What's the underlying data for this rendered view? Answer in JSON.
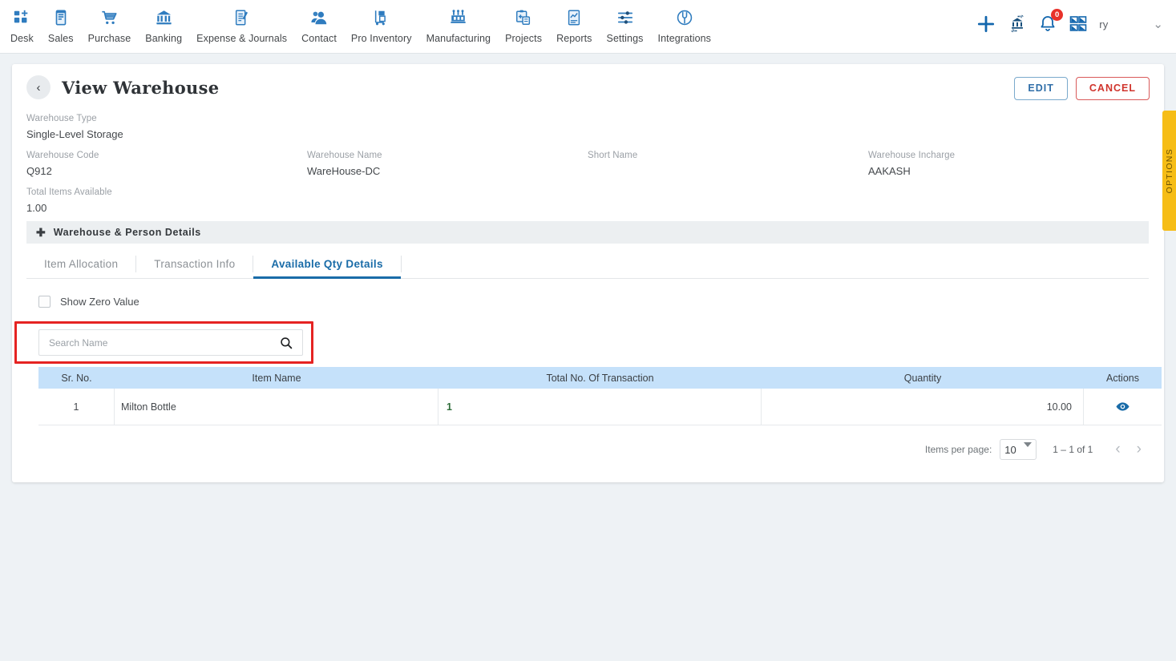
{
  "nav": {
    "items": [
      {
        "label": "Desk",
        "icon": "dashboard-icon"
      },
      {
        "label": "Sales",
        "icon": "receipt-icon"
      },
      {
        "label": "Purchase",
        "icon": "cart-icon"
      },
      {
        "label": "Banking",
        "icon": "bank-icon"
      },
      {
        "label": "Expense & Journals",
        "icon": "journal-icon"
      },
      {
        "label": "Contact",
        "icon": "contacts-icon"
      },
      {
        "label": "Pro Inventory",
        "icon": "inventory-trolley-icon"
      },
      {
        "label": "Manufacturing",
        "icon": "factory-icon"
      },
      {
        "label": "Projects",
        "icon": "clipboard-icon"
      },
      {
        "label": "Reports",
        "icon": "report-chart-icon"
      },
      {
        "label": "Settings",
        "icon": "sliders-icon"
      },
      {
        "label": "Integrations",
        "icon": "plug-icon"
      }
    ],
    "right": {
      "add_icon": "plus-icon",
      "transfer_icon": "bank-transfer-icon",
      "notification_icon": "bell-icon",
      "notification_count": "0",
      "apps_icon": "grid-apps-icon",
      "user_label": "ry",
      "chevron_icon": "chevron-down-icon"
    }
  },
  "header": {
    "back_icon": "chevron-left-icon",
    "title": "View Warehouse",
    "edit_label": "EDIT",
    "cancel_label": "CANCEL"
  },
  "fields": {
    "warehouse_type": {
      "label": "Warehouse Type",
      "value": "Single-Level Storage"
    },
    "warehouse_code": {
      "label": "Warehouse Code",
      "value": "Q912"
    },
    "warehouse_name": {
      "label": "Warehouse Name",
      "value": "WareHouse-DC"
    },
    "short_name": {
      "label": "Short Name",
      "value": ""
    },
    "warehouse_incharge": {
      "label": "Warehouse Incharge",
      "value": "AAKASH"
    },
    "total_items_available": {
      "label": "Total Items Available",
      "value": "1.00"
    }
  },
  "section": {
    "expand_icon": "plus-icon",
    "label": "Warehouse & Person Details"
  },
  "tabs": [
    {
      "label": "Item Allocation",
      "active": false
    },
    {
      "label": "Transaction Info",
      "active": false
    },
    {
      "label": "Available Qty Details",
      "active": true
    }
  ],
  "filters": {
    "show_zero_value_label": "Show Zero Value",
    "show_zero_value_checked": false
  },
  "search": {
    "placeholder": "Search Name",
    "value": "",
    "icon": "search-icon",
    "highlight_color": "#e52322"
  },
  "table": {
    "columns": [
      "Sr. No.",
      "Item Name",
      "Total No. Of Transaction",
      "Quantity",
      "Actions"
    ],
    "rows": [
      {
        "sr_no": "1",
        "item_name": "Milton Bottle",
        "total_transaction": "1",
        "quantity": "10.00",
        "action_icon": "eye-icon"
      }
    ],
    "header_bg": "#c5e1fa"
  },
  "paginator": {
    "items_per_page_label": "Items per page:",
    "items_per_page_value": "10",
    "range_label": "1 – 1 of 1",
    "prev_icon": "chevron-left-icon",
    "next_icon": "chevron-right-icon"
  },
  "options_tab": {
    "label": "OPTIONS",
    "color": "#f6bd16"
  }
}
